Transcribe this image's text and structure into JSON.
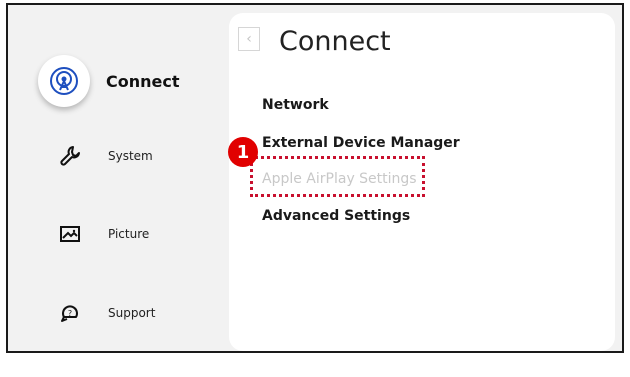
{
  "sidebar": {
    "items": [
      {
        "label": "Connect",
        "icon": "broadcast-icon",
        "active": true
      },
      {
        "label": "System",
        "icon": "wrench-icon"
      },
      {
        "label": "Picture",
        "icon": "picture-icon"
      },
      {
        "label": "Support",
        "icon": "support-icon"
      }
    ]
  },
  "panel": {
    "title": "Connect",
    "back_icon": "chevron-left-icon",
    "back_glyph": "‹",
    "menu": [
      {
        "label": "Network"
      },
      {
        "label": "External Device Manager"
      },
      {
        "label": "Apple AirPlay Settings",
        "disabled": true
      },
      {
        "label": "Advanced Settings"
      }
    ]
  },
  "annotation": {
    "step_number": "1",
    "color": "#e10000"
  },
  "colors": {
    "accent": "#1e4fbf",
    "highlight": "#c8102e"
  }
}
